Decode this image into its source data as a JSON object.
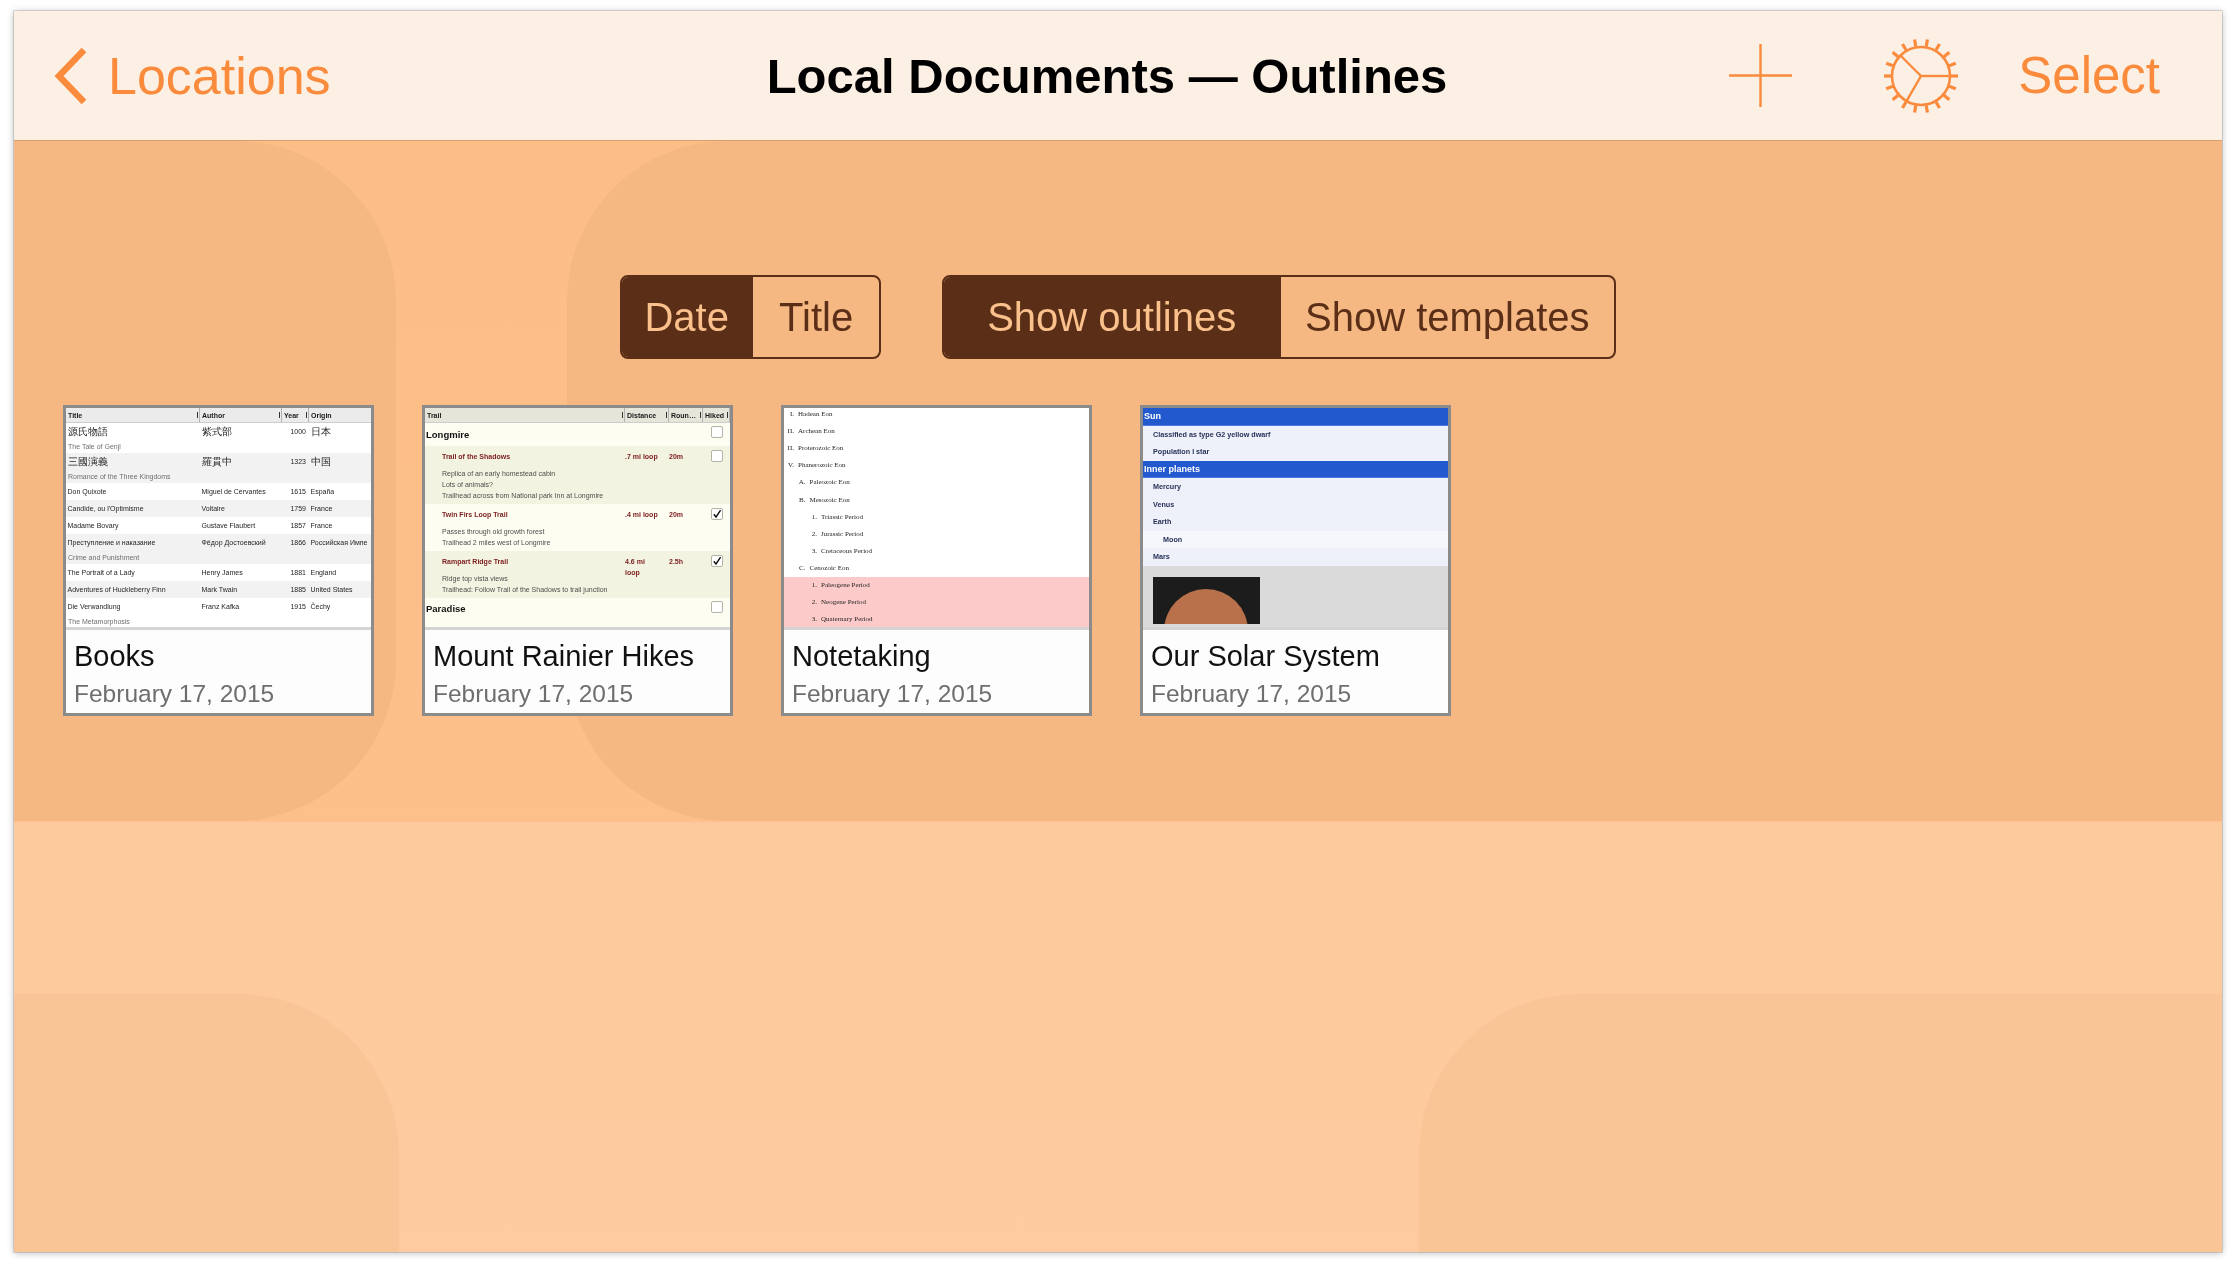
{
  "nav_bar": {
    "back_label": "Locations",
    "title": "Local Documents — Outlines",
    "action_label": "Select"
  },
  "sort_control": [
    {
      "label": "Date",
      "selected": true
    },
    {
      "label": "Title",
      "selected": false
    }
  ],
  "filter_control": [
    {
      "label": "Show outlines",
      "selected": true
    },
    {
      "label": "Show templates",
      "selected": false
    }
  ],
  "documents": [
    {
      "kind": "table",
      "title": "Books",
      "date": "February 17, 2015",
      "preview": {
        "columns": [
          "Title",
          "Author",
          "Year",
          "Origin"
        ],
        "rows": [
          {
            "cells": [
              "源氏物語",
              "紫式部",
              "1000",
              "日本"
            ],
            "note": "The Tale of Genji"
          },
          {
            "cells": [
              "三國演義",
              "羅貫中",
              "1323",
              "中国"
            ],
            "note": "Romance of the Three Kingdoms"
          },
          {
            "cells": [
              "Don Quixote",
              "Miguel de Cervantes",
              "1615",
              "España"
            ]
          },
          {
            "cells": [
              "Candide, ou l'Optimisme",
              "Voltaire",
              "1759",
              "France"
            ]
          },
          {
            "cells": [
              "Madame Bovary",
              "Gustave Flaubert",
              "1857",
              "France"
            ]
          },
          {
            "cells": [
              "Преступление и наказание",
              "Фёдор Достоевский",
              "1866",
              "Российская Импе"
            ],
            "note": "Crime and Punishment"
          },
          {
            "cells": [
              "The Portrait of a Lady",
              "Henry James",
              "1881",
              "England"
            ]
          },
          {
            "cells": [
              "Adventures of Huckleberry Finn",
              "Mark Twain",
              "1885",
              "United States"
            ]
          },
          {
            "cells": [
              "Die Verwandlung",
              "Franz Kafka",
              "1915",
              "Čechy"
            ],
            "note": "The Metamorphosis"
          }
        ]
      }
    },
    {
      "kind": "checklist",
      "title": "Mount Rainier Hikes",
      "date": "February 17, 2015",
      "preview": {
        "columns": [
          "Trail",
          "Distance",
          "Roun…",
          "Hiked"
        ],
        "rows": [
          {
            "kind": "group",
            "name": "Longmire",
            "checked": false,
            "children": [
              {
                "kind": "trail",
                "name": "Trail of the Shadows",
                "distance": ".7 mi loop",
                "duration": "20m",
                "checked": false,
                "notes": [
                  "Replica of an early homestead cabin",
                  "Lots of animals?",
                  "Trailhead across from National park Inn at Longmire"
                ]
              },
              {
                "kind": "trail",
                "name": "Twin Firs Loop Trail",
                "distance": ".4 mi loop",
                "duration": "20m",
                "checked": true,
                "notes": [
                  "Passes through old growth forest",
                  "Trailhead 2 miles west of Longmire"
                ]
              },
              {
                "kind": "trail",
                "name": "Rampart Ridge Trail",
                "distance": "4.6 mi loop",
                "duration": "2.5h",
                "checked": true,
                "notes": [
                  "Ridge top vista views",
                  "Trailhead: Follow Trail of the Shadows to trail junction"
                ]
              }
            ]
          },
          {
            "kind": "group",
            "name": "Paradise",
            "checked": false
          }
        ]
      }
    },
    {
      "kind": "outline",
      "title": "Notetaking",
      "date": "February 17, 2015",
      "preview": {
        "items": [
          {
            "marker": "I.",
            "text": "Hadean Eon",
            "highlighted": false
          },
          {
            "marker": "II.",
            "text": "Archean Eon",
            "highlighted": false
          },
          {
            "marker": "II.",
            "text": "Proterozoic Eon",
            "highlighted": false
          },
          {
            "marker": "V.",
            "text": "Phanerozoic Eon",
            "highlighted": false,
            "children": [
              {
                "marker": "A.",
                "text": "Paleozoic Eon",
                "highlighted": false
              },
              {
                "marker": "B.",
                "text": "Mesozoic Eon",
                "highlighted": false,
                "children": [
                  {
                    "marker": "1.",
                    "text": "Triassic Period",
                    "highlighted": false
                  },
                  {
                    "marker": "2.",
                    "text": "Jurassic Period",
                    "highlighted": false
                  },
                  {
                    "marker": "3.",
                    "text": "Cretaceous Period",
                    "highlighted": false
                  }
                ]
              },
              {
                "marker": "C.",
                "text": "Cenozoic Eon",
                "highlighted": false,
                "children": [
                  {
                    "marker": "1.",
                    "text": "Paleogene Period",
                    "highlighted": true
                  },
                  {
                    "marker": "2.",
                    "text": "Neogene Period",
                    "highlighted": true
                  },
                  {
                    "marker": "3.",
                    "text": "Quaternary Period",
                    "highlighted": true
                  }
                ]
              }
            ]
          }
        ]
      }
    },
    {
      "kind": "sections",
      "title": "Our Solar System",
      "date": "February 17, 2015",
      "preview": {
        "items": [
          {
            "kind": "heading",
            "text": "Sun",
            "children": [
              {
                "kind": "item",
                "text": "Classified as type G2 yellow dwarf"
              },
              {
                "kind": "item",
                "text": "Population I star"
              }
            ]
          },
          {
            "kind": "heading",
            "text": "Inner planets",
            "children": [
              {
                "kind": "item",
                "text": "Mercury"
              },
              {
                "kind": "item",
                "text": "Venus"
              },
              {
                "kind": "item",
                "text": "Earth",
                "children": [
                  {
                    "kind": "item",
                    "text": "Moon"
                  }
                ]
              },
              {
                "kind": "item",
                "text": "Mars"
              },
              {
                "kind": "image"
              }
            ]
          }
        ]
      }
    }
  ]
}
